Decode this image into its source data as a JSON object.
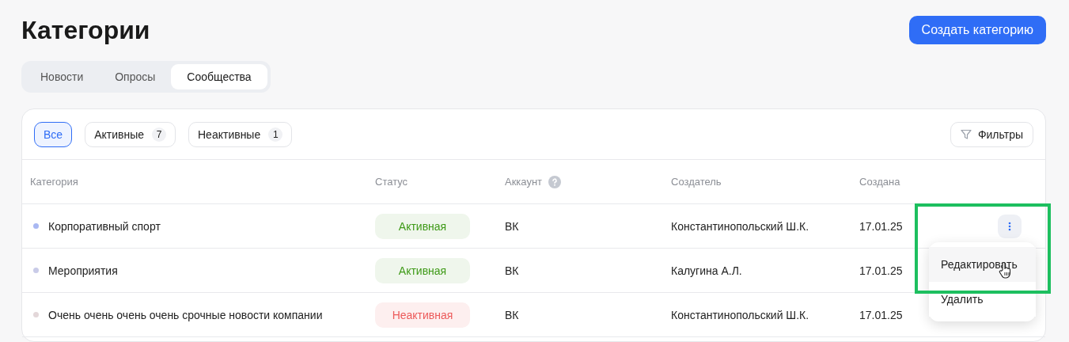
{
  "title": "Категории",
  "create_button": "Создать категорию",
  "tabs": [
    {
      "label": "Новости",
      "selected": false
    },
    {
      "label": "Опросы",
      "selected": false
    },
    {
      "label": "Сообщества",
      "selected": true
    }
  ],
  "filters": [
    {
      "label": "Все",
      "selected": true
    },
    {
      "label": "Активные",
      "count": "7",
      "selected": false
    },
    {
      "label": "Неактивные",
      "count": "1",
      "selected": false
    }
  ],
  "filters_button": "Фильтры",
  "table": {
    "columns": [
      "Категория",
      "Статус",
      "Аккаунт",
      "Создатель",
      "Создана"
    ],
    "rows": [
      {
        "name": "Корпоративный спорт",
        "color": "#a9b8f2",
        "status": "Активная",
        "active": true,
        "account": "ВК",
        "creator": "Константинопольский Ш.К.",
        "created": "17.01.25",
        "menu_open": true
      },
      {
        "name": "Мероприятия",
        "color": "#c9cbe8",
        "status": "Активная",
        "active": true,
        "account": "ВК",
        "creator": "Калугина А.Л.",
        "created": "17.01.25",
        "menu_open": false
      },
      {
        "name": "Очень очень очень очень срочные новости компании",
        "color": "#e3d7d9",
        "status": "Неактивная",
        "active": false,
        "account": "ВК",
        "creator": "Константинопольский Ш.К.",
        "created": "17.01.25",
        "menu_open": false
      }
    ]
  },
  "menu": [
    {
      "label": "Редактировать",
      "hovered": true
    },
    {
      "label": "Удалить",
      "hovered": false
    }
  ]
}
